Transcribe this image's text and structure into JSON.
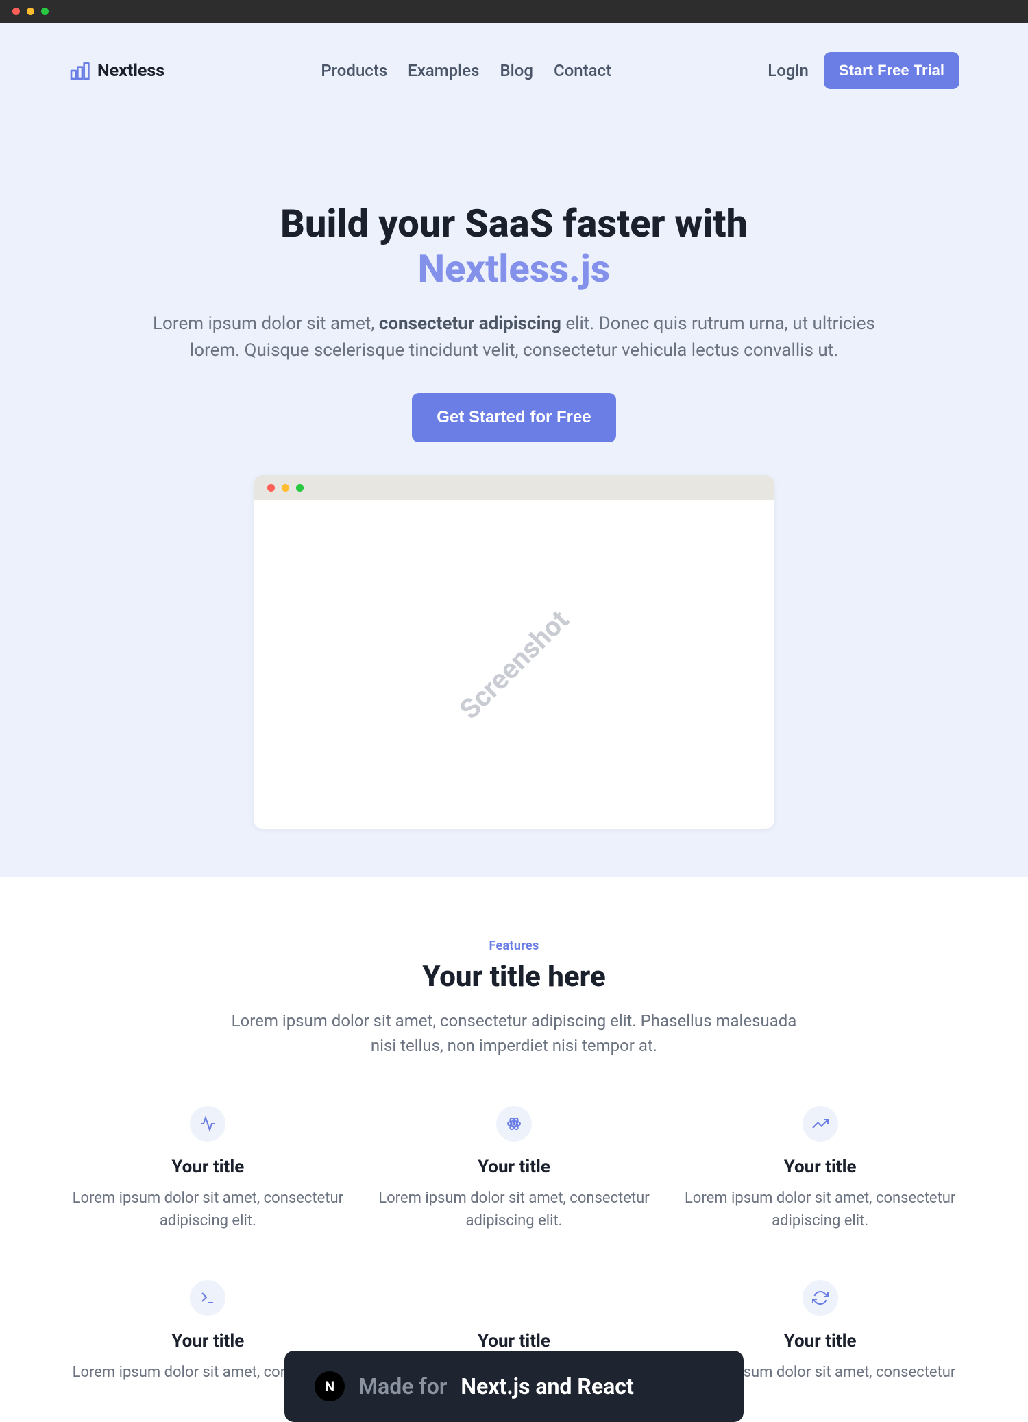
{
  "brand": {
    "name": "Nextless"
  },
  "nav": {
    "items": [
      "Products",
      "Examples",
      "Blog",
      "Contact"
    ]
  },
  "auth": {
    "login_label": "Login",
    "trial_label": "Start Free Trial"
  },
  "hero": {
    "title_line1": "Build your SaaS faster with",
    "title_accent": "Nextless.js",
    "desc_before": "Lorem ipsum dolor sit amet, ",
    "desc_bold": "consectetur adipiscing",
    "desc_after": " elit. Donec quis rutrum urna, ut ultricies lorem. Quisque scelerisque tincidunt velit, consectetur vehicula lectus convallis ut.",
    "cta_label": "Get Started for Free",
    "screenshot_placeholder": "Screenshot"
  },
  "features": {
    "eyebrow": "Features",
    "title": "Your title here",
    "desc": "Lorem ipsum dolor sit amet, consectetur adipiscing elit. Phasellus malesuada nisi tellus, non imperdiet nisi tempor at.",
    "items": [
      {
        "title": "Your title",
        "text": "Lorem ipsum dolor sit amet, consectetur adipiscing elit.",
        "icon": "activity"
      },
      {
        "title": "Your title",
        "text": "Lorem ipsum dolor sit amet, consectetur adipiscing elit.",
        "icon": "atom"
      },
      {
        "title": "Your title",
        "text": "Lorem ipsum dolor sit amet, consectetur adipiscing elit.",
        "icon": "trending-up"
      },
      {
        "title": "Your title",
        "text": "Lorem ipsum dolor sit amet, consectetur",
        "icon": "terminal"
      },
      {
        "title": "Your title",
        "text": "",
        "icon": "hidden"
      },
      {
        "title": "Your title",
        "text": "Lorem ipsum dolor sit amet, consectetur",
        "icon": "refresh"
      }
    ]
  },
  "badge": {
    "prefix": "Made for",
    "main": "Next.js and React",
    "icon_letter": "N"
  }
}
